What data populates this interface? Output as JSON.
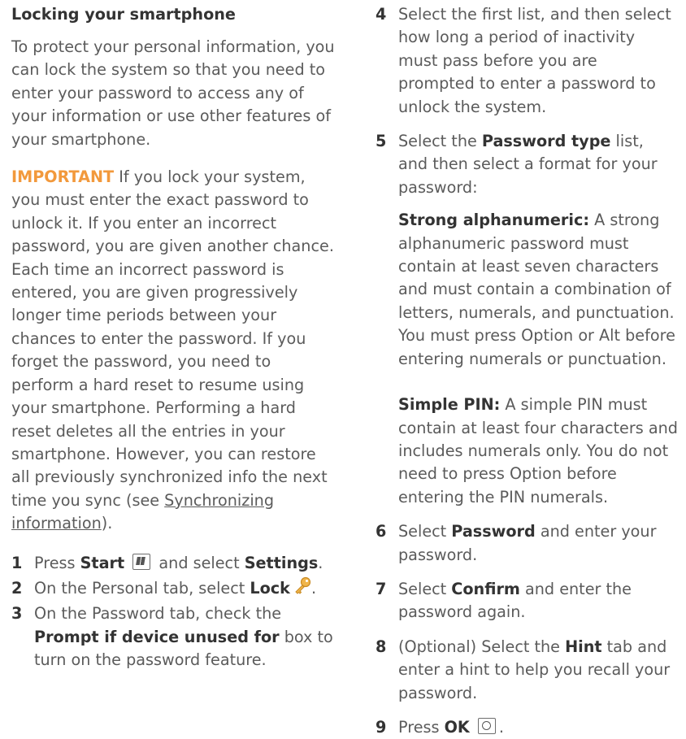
{
  "left": {
    "title": "Locking your smartphone",
    "intro": "To protect your personal information, you can lock the system so that you need to enter your password to access any of your information or use other features of your smartphone.",
    "important_keyword": "IMPORTANT",
    "important_text": " If you lock your system, you must enter the exact password to unlock it. If you enter an incorrect password, you are given another chance. Each time an incorrect password is entered, you are given progressively longer time periods between your chances to enter the password. If you forget the password, you need to perform a hard reset to resume using your smartphone. Performing a hard reset deletes all the entries in your smartphone. However, you can restore all previously synchronized info the next time you sync (see ",
    "important_link": "Synchronizing information",
    "important_end": ").",
    "steps": [
      {
        "num": "1",
        "pre": "Press ",
        "b1": "Start",
        "mid": " and select ",
        "b2": "Settings",
        "post": "."
      },
      {
        "num": "2",
        "pre": "On the Personal tab, select ",
        "b1": "Lock"
      },
      {
        "num": "3",
        "pre": "On the Password tab, check the ",
        "b1": "Prompt if device unused for",
        "post": " box to turn on the password feature."
      }
    ]
  },
  "right": {
    "steps": [
      {
        "num": "4",
        "text": "Select the first list, and then select how long a period of inactivity must pass before you are prompted to enter a password to unlock the system."
      },
      {
        "num": "5",
        "pre": "Select the ",
        "b1": "Password type",
        "post": " list, and then select a format for your password:",
        "sub1_label": "Strong alphanumeric:",
        "sub1_text": " A strong alphanumeric password must contain at least seven characters and must contain a combination of letters, numerals, and punctuation. You must press Option or Alt before entering numerals or punctuation.",
        "sub2_label": "Simple PIN:",
        "sub2_text": " A simple PIN must contain at least four characters and includes numerals only. You do not need to press Option before entering the PIN numerals."
      },
      {
        "num": "6",
        "pre": "Select ",
        "b1": "Password",
        "post": " and enter your password."
      },
      {
        "num": "7",
        "pre": "Select ",
        "b1": "Confirm",
        "post": " and enter the password again."
      },
      {
        "num": "8",
        "pre": "(Optional) Select the ",
        "b1": "Hint",
        "post": " tab and enter a hint to help you recall your password."
      },
      {
        "num": "9",
        "pre": "Press ",
        "b1": "OK",
        "post": "."
      }
    ]
  },
  "colors": {
    "important": "#f2993c",
    "text": "#5b5b5b",
    "bold": "#333333"
  }
}
